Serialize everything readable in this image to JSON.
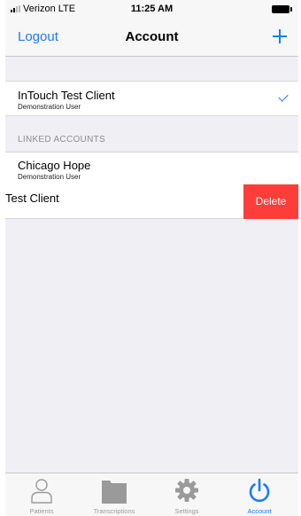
{
  "status_bar": {
    "carrier": "Verizon  LTE",
    "time": "11:25 AM"
  },
  "nav": {
    "left_label": "Logout",
    "title": "Account",
    "add_icon": "plus-icon"
  },
  "accounts": {
    "current": {
      "name": "InTouch Test Client",
      "user": "Demonstration User",
      "selected": true
    },
    "linked_header": "LINKED ACCOUNTS",
    "linked": [
      {
        "name": "Chicago Hope",
        "user": "Demonstration User"
      },
      {
        "name": "Test Client",
        "delete_label": "Delete"
      }
    ]
  },
  "tab_bar": {
    "tabs": [
      {
        "label": "Patients",
        "icon": "person-icon",
        "active": false
      },
      {
        "label": "Transcriptions",
        "icon": "folder-icon",
        "active": false
      },
      {
        "label": "Settings",
        "icon": "gear-icon",
        "active": false
      },
      {
        "label": "Account",
        "icon": "power-icon",
        "active": true
      }
    ]
  },
  "colors": {
    "accent": "#1a7bff",
    "delete": "#fc3d39",
    "inactive_tab": "#9a9a9a",
    "background": "#efeff4"
  }
}
